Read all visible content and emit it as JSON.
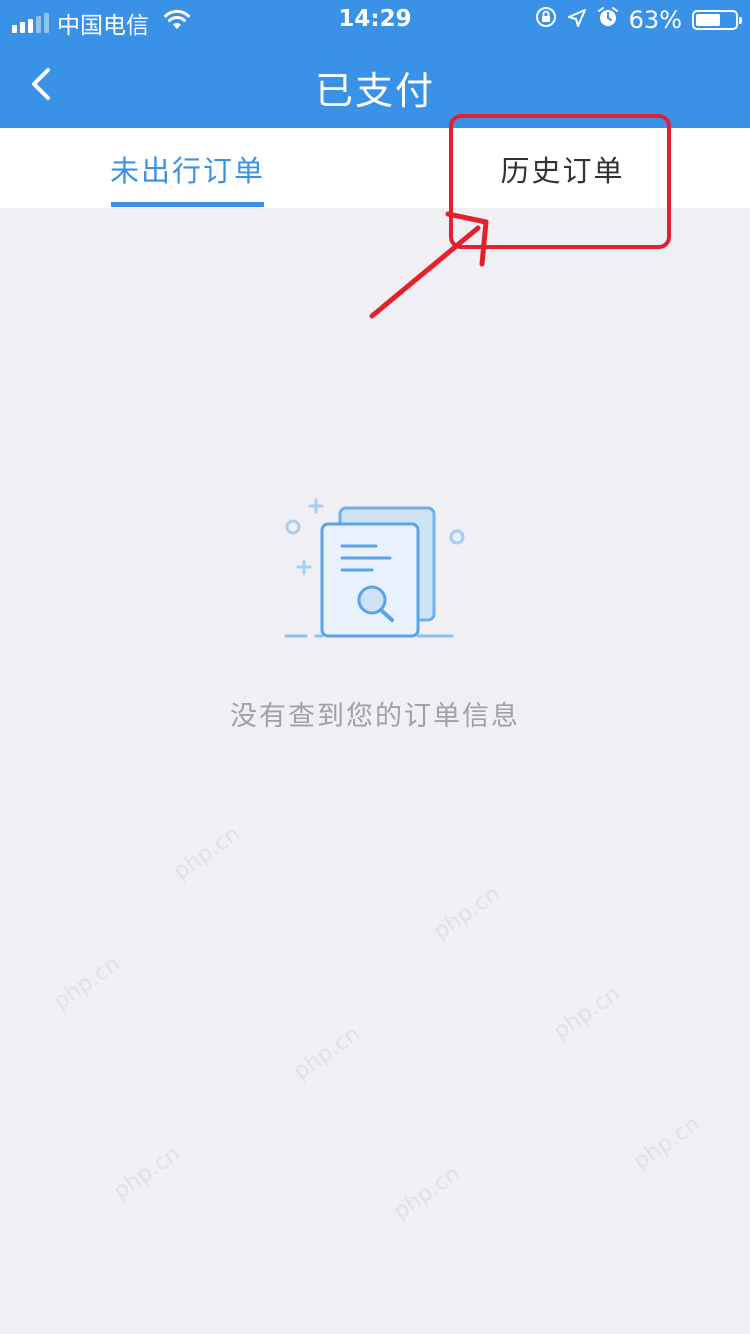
{
  "status_bar": {
    "carrier": "中国电信",
    "time": "14:29",
    "battery_percent": "63%",
    "battery_level": 0.63
  },
  "nav": {
    "title": "已支付",
    "back_icon": "chevron-left-icon"
  },
  "tabs": [
    {
      "label": "未出行订单",
      "active": true
    },
    {
      "label": "历史订单",
      "active": false
    }
  ],
  "empty_state": {
    "icon": "document-search-icon",
    "message": "没有查到您的订单信息"
  },
  "annotation": {
    "color": "#e4202d"
  },
  "watermark": {
    "text": "php.cn"
  },
  "colors": {
    "primary": "#3a92e8",
    "background": "#efeff4",
    "empty_text": "#a0a0a6"
  }
}
